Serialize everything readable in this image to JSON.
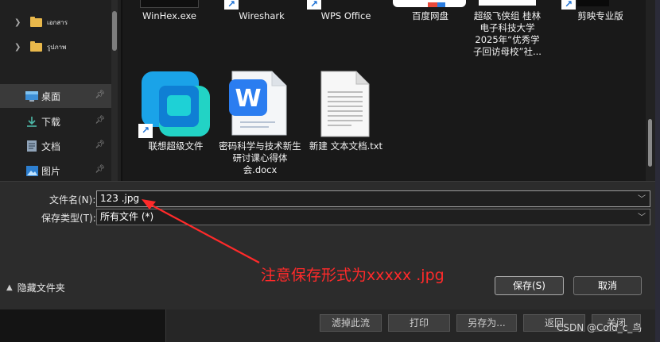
{
  "sidebar": {
    "tree_items": [
      {
        "label": "เอกสาร"
      },
      {
        "label": "รูปภาพ"
      }
    ],
    "quick_access": [
      {
        "label": "桌面",
        "icon": "desktop-icon"
      },
      {
        "label": "下载",
        "icon": "download-icon"
      },
      {
        "label": "文档",
        "icon": "document-icon"
      },
      {
        "label": "图片",
        "icon": "pictures-icon"
      }
    ]
  },
  "files": {
    "top_row": [
      "WinHex.exe",
      "Wireshark",
      "WPS Office",
      "百度网盘",
      "超级飞侠组 桂林电子科技大学2025年“优秀学子回访母校”社...",
      "剪映专业版"
    ],
    "items": [
      {
        "label": "联想超级文件"
      },
      {
        "label": "密码科学与技术新生研讨课心得体会.docx"
      },
      {
        "label": "新建 文本文档.txt"
      }
    ]
  },
  "form": {
    "filename_label": "文件名(N):",
    "filename_value": "123 .jpg",
    "filetype_label": "保存类型(T):",
    "filetype_value": "所有文件 (*)"
  },
  "buttons": {
    "hide_folders": "隐藏文件夹",
    "save": "保存(S)",
    "cancel": "取消"
  },
  "annotation": "注意保存形式为xxxxx .jpg",
  "background": {
    "buttons": [
      "滤掉此流",
      "打印",
      "另存为...",
      "返回",
      "关闭"
    ],
    "watermark": "CSDN @Cold_c_鸟"
  },
  "colors": {
    "annotation": "#ff2a2a",
    "folder": "#e9b84b",
    "pane": "#2c2c2c"
  }
}
